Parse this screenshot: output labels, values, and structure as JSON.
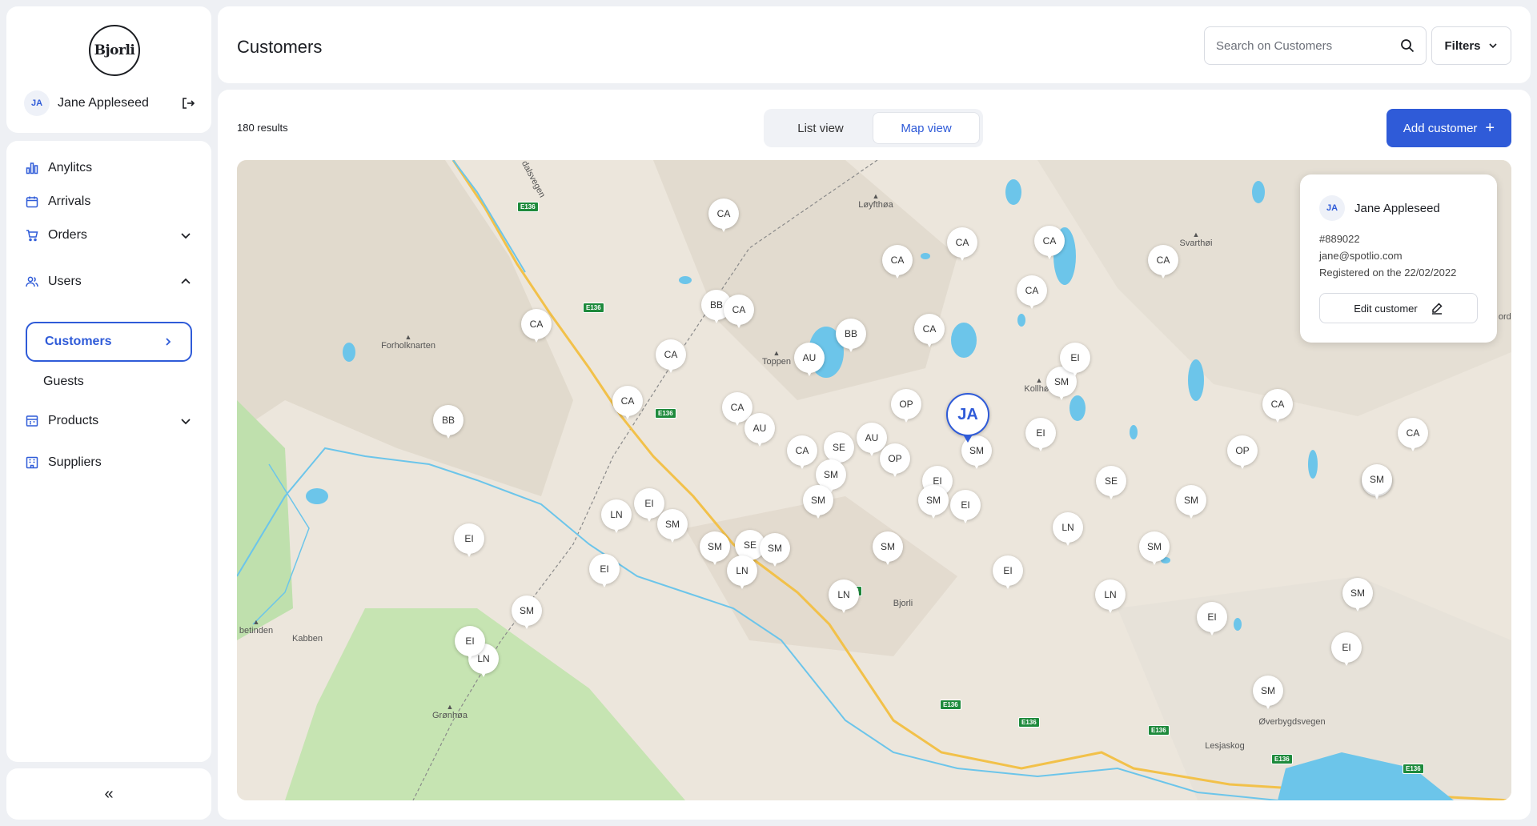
{
  "sidebar": {
    "logo_text": "Bjorli",
    "user": {
      "initials": "JA",
      "name": "Jane Appleseed"
    },
    "nav": {
      "analytics": "Anylitcs",
      "arrivals": "Arrivals",
      "orders": "Orders",
      "users": "Users",
      "customers": "Customers",
      "guests": "Guests",
      "products": "Products",
      "suppliers": "Suppliers"
    },
    "collapse_label": "«"
  },
  "header": {
    "title": "Customers",
    "search_placeholder": "Search on Customers",
    "filters_label": "Filters"
  },
  "content": {
    "results": "180 results",
    "tabs": {
      "list": "List view",
      "map": "Map view",
      "active": "map"
    },
    "add_label": "Add customer",
    "add_icon": "+"
  },
  "map": {
    "selected_pin": "JA",
    "pin_labels": [
      "CA",
      "CA",
      "CA",
      "CA",
      "CA",
      "CA",
      "BB",
      "CA",
      "CA",
      "CA",
      "BB",
      "AU",
      "CA",
      "CA",
      "BB",
      "CA",
      "OP",
      "SM",
      "AU",
      "EI",
      "CA",
      "CA",
      "SE",
      "AU",
      "OP",
      "EI",
      "SM",
      "SM",
      "EI",
      "SE",
      "SM",
      "EI",
      "SM",
      "LN",
      "EI",
      "SM",
      "OP",
      "EI",
      "SM",
      "SE",
      "SM",
      "LN",
      "EI",
      "EI",
      "LN",
      "SM",
      "EI",
      "SM",
      "LN",
      "EI",
      "LN",
      "SM",
      "LN",
      "SM",
      "EI",
      "SM",
      "EI",
      "SM",
      "CA",
      "SM"
    ],
    "places": [
      "Løyfthøa",
      "Svarthøi",
      "Forholknarten",
      "Toppen",
      "Kollhøe",
      "Bjorli",
      "Kabben",
      "betinden",
      "Grønhøa",
      "Lesjaskog",
      "Øverbygdsvegen"
    ],
    "road": "E136",
    "road_label": "dalsvegen",
    "edge_label": "ordi"
  },
  "popup": {
    "initials": "JA",
    "name": "Jane Appleseed",
    "id": "#889022",
    "email": "jane@spotlio.com",
    "registered": "Registered on the 22/02/2022",
    "edit_label": "Edit customer"
  }
}
